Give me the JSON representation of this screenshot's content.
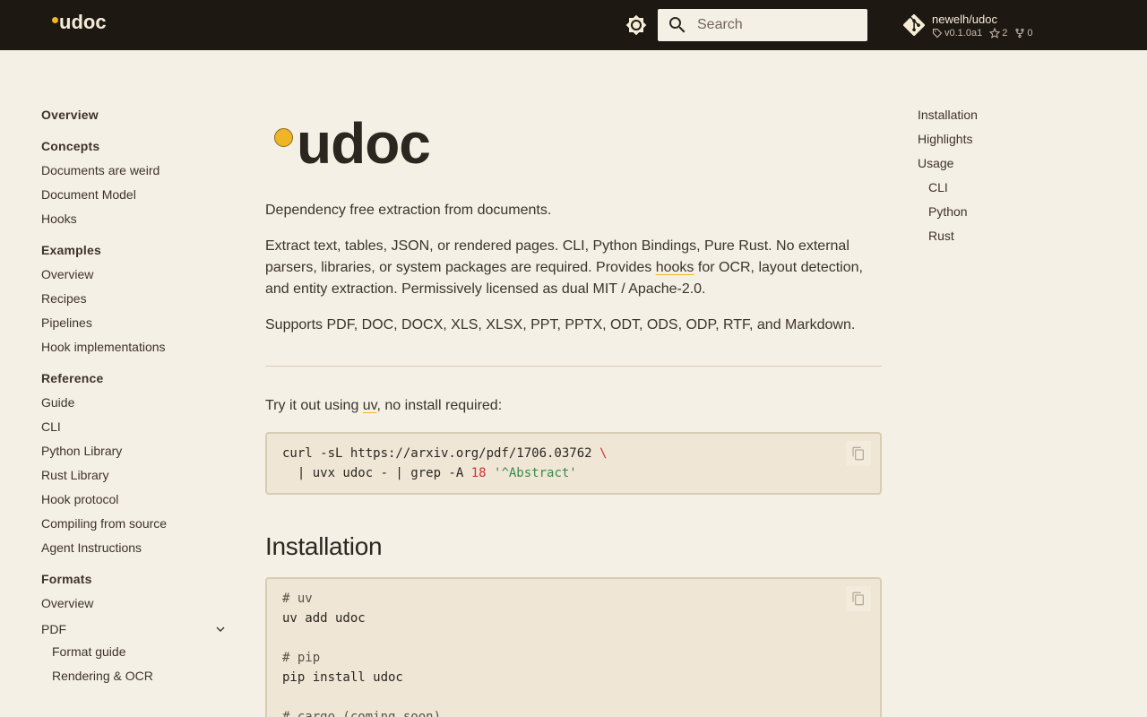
{
  "header": {
    "brand": "udoc",
    "search_placeholder": "Search",
    "repo": {
      "name": "newelh/udoc",
      "version": "v0.1.0a1",
      "stars": "2",
      "forks": "0"
    }
  },
  "nav": {
    "overview": "Overview",
    "concepts": {
      "title": "Concepts",
      "items": [
        "Documents are weird",
        "Document Model",
        "Hooks"
      ]
    },
    "examples": {
      "title": "Examples",
      "items": [
        "Overview",
        "Recipes",
        "Pipelines",
        "Hook implementations"
      ]
    },
    "reference": {
      "title": "Reference",
      "items": [
        "Guide",
        "CLI",
        "Python Library",
        "Rust Library",
        "Hook protocol",
        "Compiling from source",
        "Agent Instructions"
      ]
    },
    "formats": {
      "title": "Formats",
      "items": [
        "Overview",
        "PDF"
      ],
      "pdf_sub": [
        "Format guide",
        "Rendering & OCR"
      ]
    }
  },
  "main": {
    "logo_text": "udoc",
    "tagline": "Dependency free extraction from documents.",
    "para2_a": "Extract text, tables, JSON, or rendered pages. CLI, Python Bindings, Pure Rust. No external parsers, libraries, or system packages are required. Provides ",
    "para2_link": "hooks",
    "para2_b": " for OCR, layout detection, and entity extraction. Permissively licensed as dual MIT / Apache-2.0.",
    "para3": "Supports PDF, DOC, DOCX, XLS, XLSX, PPT, PPTX, ODT, ODS, ODP, RTF, and Markdown.",
    "try_a": "Try it out using ",
    "try_link": "uv",
    "try_b": ", no install required:",
    "code1": {
      "l1_cmd": "curl -sL https://arxiv.org/pdf/1706.03762 ",
      "l1_cont": "\\",
      "l2_cmd": "  | uvx udoc - | grep -A ",
      "l2_num": "18",
      "l2_space": " ",
      "l2_str": "'^Abstract'"
    },
    "installation_heading": "Installation",
    "code2": {
      "c1": "# uv",
      "l1": "uv add udoc",
      "c2": "# pip",
      "l2": "pip install udoc",
      "c3": "# cargo (coming soon)"
    }
  },
  "toc": {
    "items": [
      "Installation",
      "Highlights",
      "Usage"
    ],
    "usage_sub": [
      "CLI",
      "Python",
      "Rust"
    ]
  }
}
